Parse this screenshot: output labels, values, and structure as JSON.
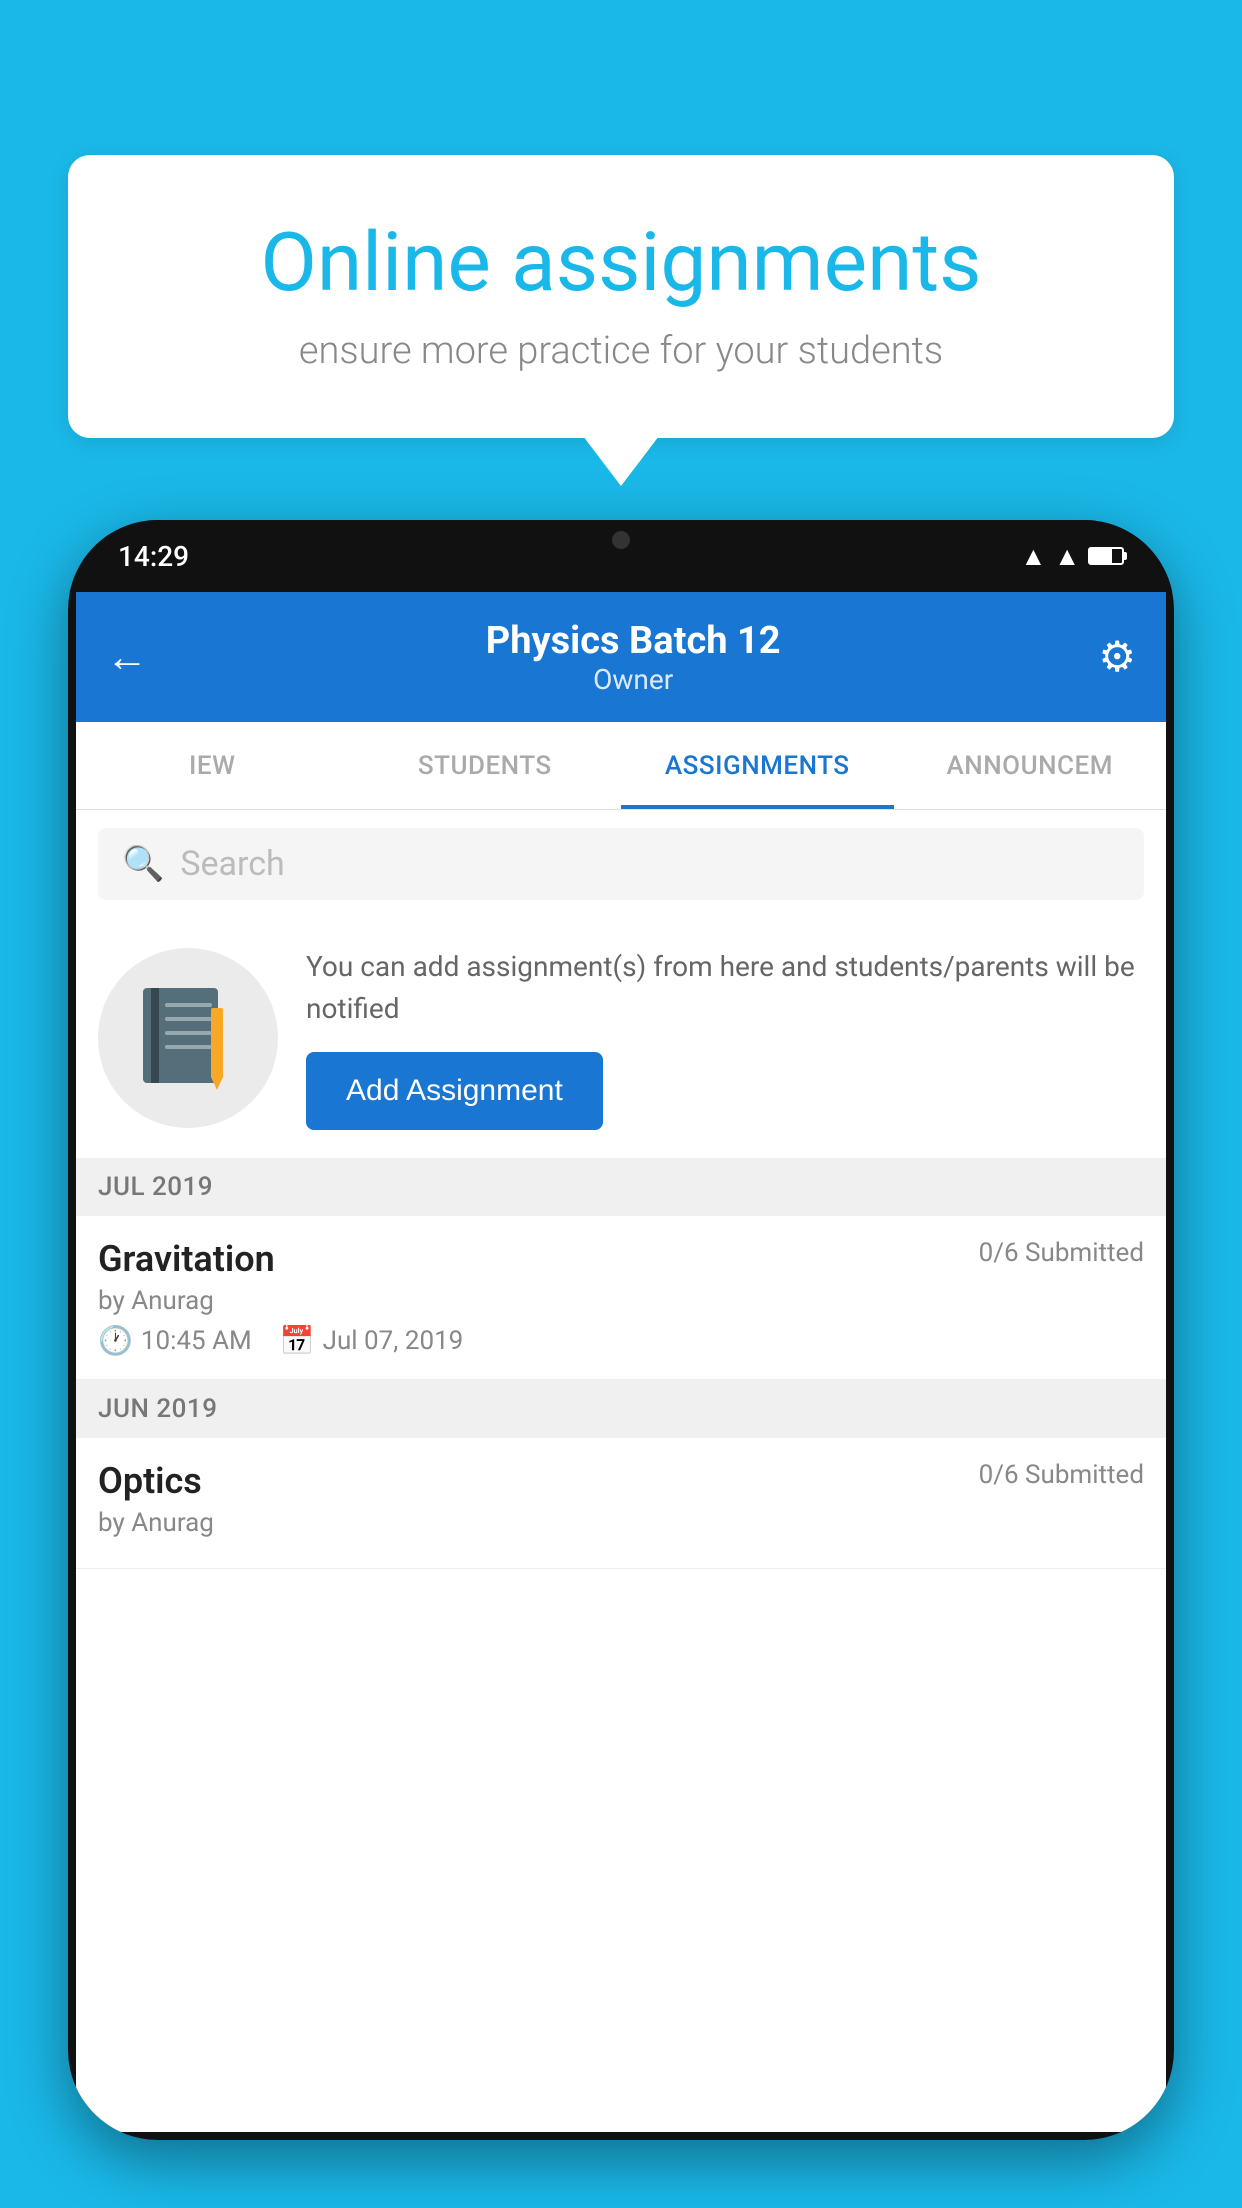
{
  "background": {
    "color": "#1ab8e8"
  },
  "speech_bubble": {
    "title": "Online assignments",
    "subtitle": "ensure more practice for your students"
  },
  "phone": {
    "time": "14:29",
    "app_bar": {
      "title": "Physics Batch 12",
      "subtitle": "Owner",
      "back_label": "←",
      "settings_label": "⚙"
    },
    "tabs": [
      {
        "label": "IEW",
        "active": false
      },
      {
        "label": "STUDENTS",
        "active": false
      },
      {
        "label": "ASSIGNMENTS",
        "active": true
      },
      {
        "label": "ANNOUNCEM",
        "active": false
      }
    ],
    "search": {
      "placeholder": "Search"
    },
    "promo": {
      "description": "You can add assignment(s) from here and students/parents will be notified",
      "button_label": "Add Assignment"
    },
    "sections": [
      {
        "header": "JUL 2019",
        "items": [
          {
            "title": "Gravitation",
            "status": "0/6 Submitted",
            "author": "by Anurag",
            "time": "10:45 AM",
            "date": "Jul 07, 2019"
          }
        ]
      },
      {
        "header": "JUN 2019",
        "items": [
          {
            "title": "Optics",
            "status": "0/6 Submitted",
            "author": "by Anurag",
            "time": "",
            "date": ""
          }
        ]
      }
    ]
  }
}
